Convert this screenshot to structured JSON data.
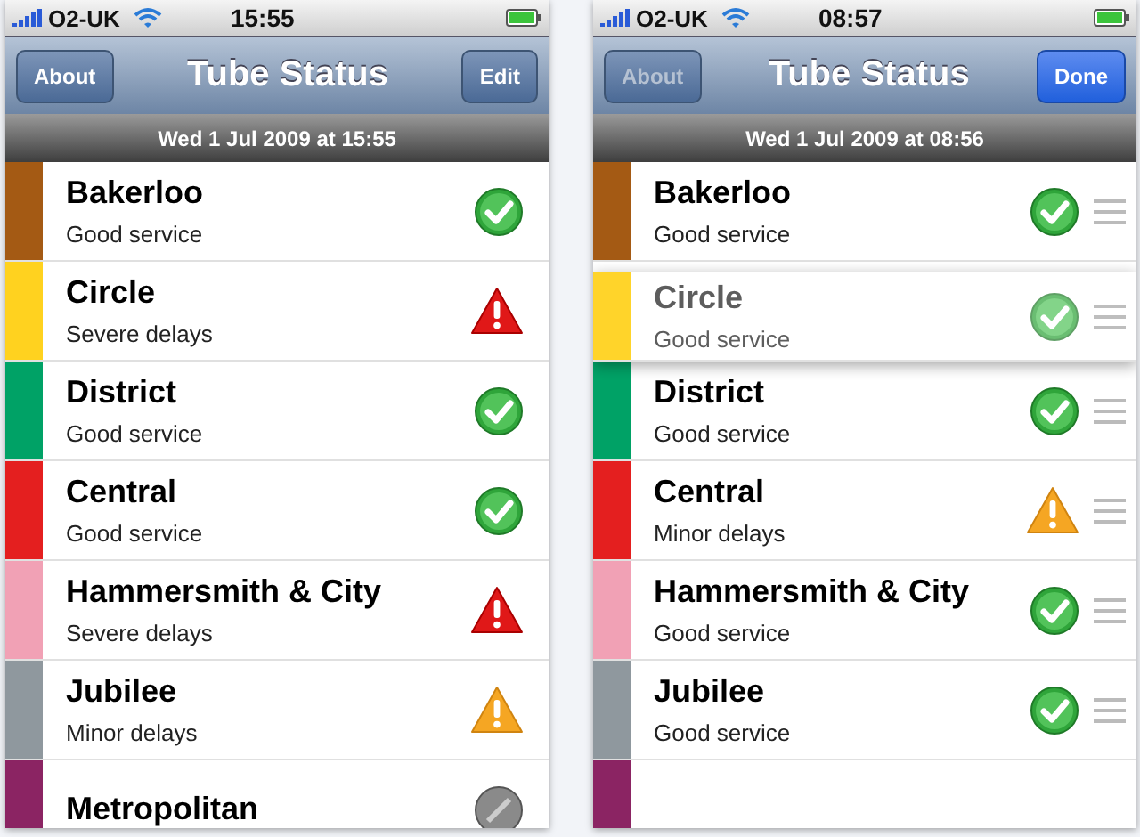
{
  "screens": [
    {
      "status_bar": {
        "carrier": "O2-UK",
        "time": "15:55"
      },
      "nav": {
        "left_button": {
          "label": "About",
          "disabled": false
        },
        "title": "Tube Status",
        "right_button": {
          "label": "Edit"
        }
      },
      "updated": "Wed 1 Jul 2009 at 15:55",
      "editing": false,
      "lines": [
        {
          "name": "Bakerloo",
          "status": "Good service",
          "kind": "good",
          "color": "#a45a14",
          "dragging": false
        },
        {
          "name": "Circle",
          "status": "Severe delays",
          "kind": "severe",
          "color": "#ffd21f",
          "dragging": false
        },
        {
          "name": "District",
          "status": "Good service",
          "kind": "good",
          "color": "#00a266",
          "dragging": false
        },
        {
          "name": "Central",
          "status": "Good service",
          "kind": "good",
          "color": "#e41f1f",
          "dragging": false
        },
        {
          "name": "Hammersmith & City",
          "status": "Severe delays",
          "kind": "severe",
          "color": "#f1a1b5",
          "dragging": false
        },
        {
          "name": "Jubilee",
          "status": "Minor delays",
          "kind": "minor",
          "color": "#8f989e",
          "dragging": false
        },
        {
          "name": "Metropolitan",
          "kind": "unknown",
          "color": "#8b2463",
          "dragging": false
        }
      ]
    },
    {
      "status_bar": {
        "carrier": "O2-UK",
        "time": "08:57"
      },
      "nav": {
        "left_button": {
          "label": "About",
          "disabled": true
        },
        "title": "Tube Status",
        "right_button": {
          "label": "Done"
        }
      },
      "updated": "Wed 1 Jul 2009 at 08:56",
      "editing": true,
      "lines": [
        {
          "name": "Bakerloo",
          "status": "Good service",
          "kind": "good",
          "color": "#a45a14",
          "dragging": false
        },
        {
          "name": "Circle",
          "status": "Good service",
          "kind": "good",
          "color": "#ffd21f",
          "dragging": true
        },
        {
          "name": "District",
          "status": "Good service",
          "kind": "good",
          "color": "#00a266",
          "dragging": false
        },
        {
          "name": "Central",
          "status": "Minor delays",
          "kind": "minor",
          "color": "#e41f1f",
          "dragging": false
        },
        {
          "name": "Hammersmith & City",
          "status": "Good service",
          "kind": "good",
          "color": "#f1a1b5",
          "dragging": false
        },
        {
          "name": "Jubilee",
          "status": "Good service",
          "kind": "good",
          "color": "#8f989e",
          "dragging": false
        },
        {
          "color": "#8b2463",
          "dragging": false
        }
      ]
    }
  ]
}
